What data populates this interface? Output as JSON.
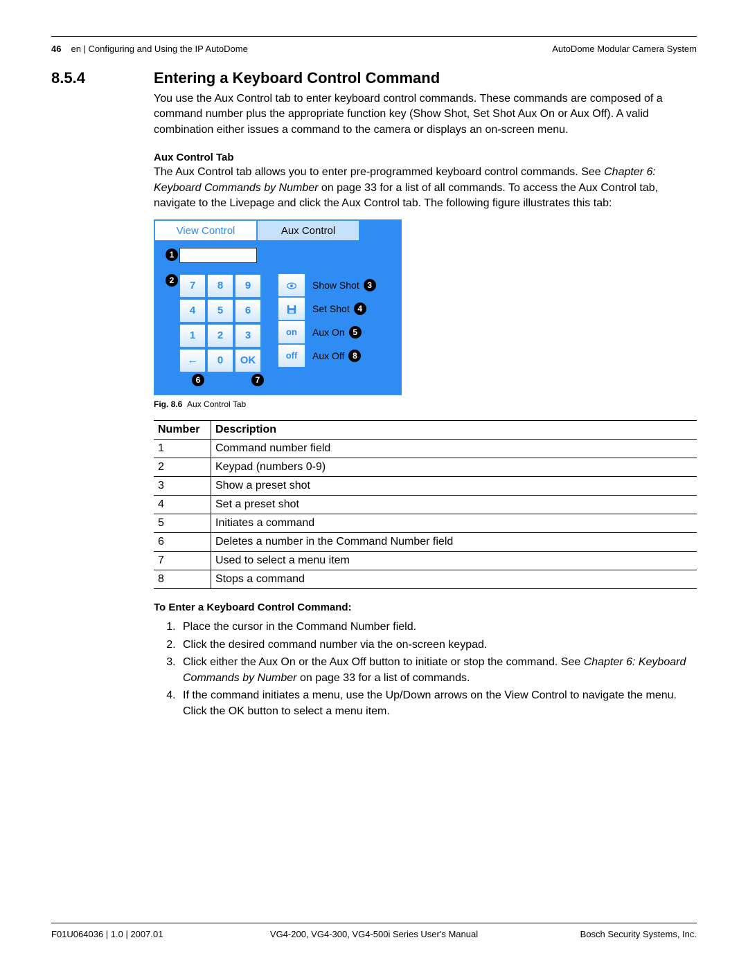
{
  "header": {
    "page_number": "46",
    "left": "en | Configuring and Using the IP AutoDome",
    "right": "AutoDome Modular Camera System"
  },
  "section": {
    "number": "8.5.4",
    "title": "Entering a Keyboard Control Command",
    "intro": "You use the Aux Control tab to enter keyboard control commands. These commands are composed of a command number plus the appropriate function key (Show Shot, Set Shot Aux On or Aux Off). A valid combination either issues a command to the camera or displays an on-screen menu.",
    "subtitle1": "Aux Control Tab",
    "sub1_p1a": "The Aux Control tab allows you to enter pre-programmed keyboard control commands. See ",
    "sub1_p1_ital": "Chapter 6: Keyboard Commands by Number",
    "sub1_p1b": " on page 33 for a list of all commands. To access the Aux Control tab, navigate to the Livepage and click the Aux Control tab. The following figure illustrates this tab:"
  },
  "figure": {
    "tabs": {
      "view_control": "View Control",
      "aux_control": "Aux Control"
    },
    "keys": {
      "7": "7",
      "8": "8",
      "9": "9",
      "4": "4",
      "5": "5",
      "6": "6",
      "1": "1",
      "2": "2",
      "3": "3",
      "back": "←",
      "0": "0",
      "ok": "OK"
    },
    "funcs": {
      "show_shot_btn": "●",
      "show_shot": "Show Shot",
      "set_shot_btn": "💾",
      "set_shot": "Set Shot",
      "aux_on_btn": "on",
      "aux_on": "Aux On",
      "aux_off_btn": "off",
      "aux_off": "Aux Off"
    },
    "callouts": {
      "1": "1",
      "2": "2",
      "3": "3",
      "4": "4",
      "5": "5",
      "6": "6",
      "7": "7",
      "8": "8"
    },
    "caption_bold": "Fig. 8.6",
    "caption": "Aux Control Tab"
  },
  "table": {
    "head_number": "Number",
    "head_desc": "Description",
    "rows": [
      {
        "n": "1",
        "d": "Command number field"
      },
      {
        "n": "2",
        "d": "Keypad (numbers 0-9)"
      },
      {
        "n": "3",
        "d": "Show a preset shot"
      },
      {
        "n": "4",
        "d": "Set a preset shot"
      },
      {
        "n": "5",
        "d": "Initiates a command"
      },
      {
        "n": "6",
        "d": "Deletes a number in the Command Number field"
      },
      {
        "n": "7",
        "d": "Used to select a menu item"
      },
      {
        "n": "8",
        "d": "Stops a command"
      }
    ]
  },
  "enter": {
    "heading": "To Enter a Keyboard Control Command:",
    "step1": "Place the cursor in the Command Number field.",
    "step2": "Click the desired command number via the on-screen keypad.",
    "step3a": "Click either the Aux On or the Aux Off button to initiate or stop the command. See ",
    "step3_ital": "Chapter 6: Keyboard Commands by Number",
    "step3b": " on page 33 for a list of commands.",
    "step4": "If the command initiates a menu, use the Up/Down arrows on the View Control to navigate the menu. Click the OK button to select a menu item."
  },
  "footer": {
    "left": "F01U064036 | 1.0 | 2007.01",
    "center": "VG4-200, VG4-300, VG4-500i Series User's Manual",
    "right": "Bosch Security Systems, Inc."
  }
}
